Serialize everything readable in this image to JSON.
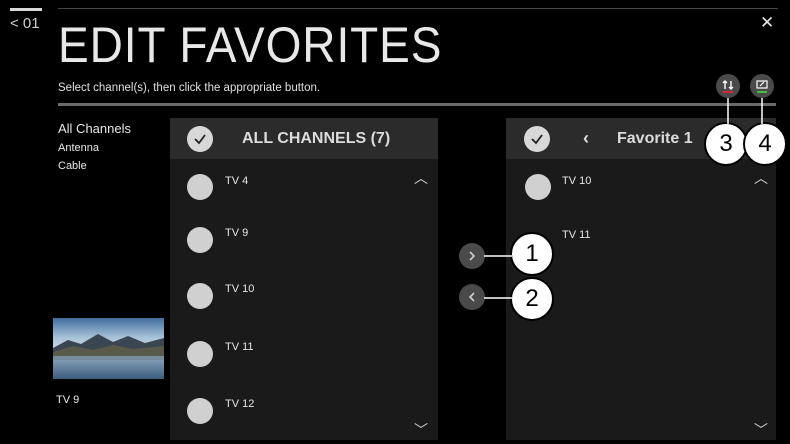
{
  "back": {
    "label": "< 01"
  },
  "header": {
    "title": "EDIT FAVORITES",
    "instruction": "Select channel(s), then click the appropriate button.",
    "close_label": "✕"
  },
  "categories": [
    {
      "label": "All Channels"
    },
    {
      "label": "Antenna"
    },
    {
      "label": "Cable"
    }
  ],
  "preview": {
    "label": "TV 9"
  },
  "all_channels_panel": {
    "title": "ALL CHANNELS (7)",
    "channels": [
      "TV 4",
      "TV 9",
      "TV 10",
      "TV 11",
      "TV 12"
    ]
  },
  "favorite_panel": {
    "title": "Favorite 1",
    "prev_label": "‹",
    "channels": [
      "TV 10",
      "TV 11"
    ]
  },
  "callouts": [
    "1",
    "2",
    "3",
    "4"
  ],
  "colors": {
    "background": "#000000",
    "panel": "#1a1a1a",
    "panel_header": "#2b2b2b",
    "red_indicator": "#d9263c",
    "green_indicator": "#3fbf3f"
  },
  "icons": [
    "move-right-icon",
    "move-left-icon",
    "reorder-icon",
    "rename-icon",
    "close-icon",
    "check-icon"
  ]
}
